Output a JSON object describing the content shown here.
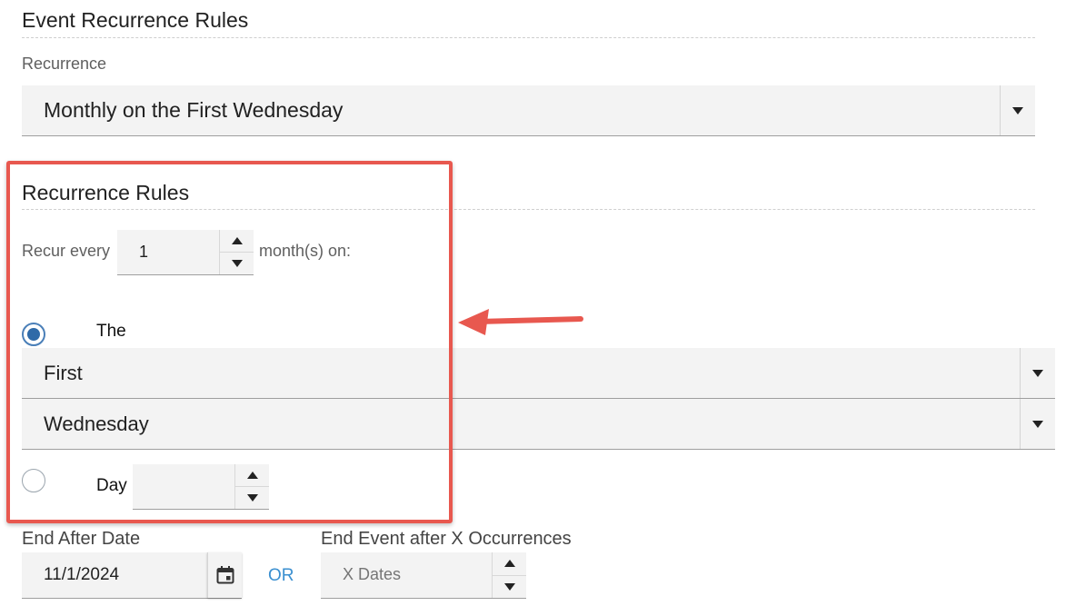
{
  "event_recurrence": {
    "heading": "Event Recurrence Rules",
    "recurrence_label": "Recurrence",
    "recurrence_value": "Monthly on the First Wednesday"
  },
  "recurrence_rules": {
    "heading": "Recurrence Rules",
    "recur_every_label": "Recur every",
    "recur_every_value": "1",
    "recur_unit_label": "month(s) on:",
    "option_the_label": "The",
    "option_the_selected": true,
    "ordinal_value": "First",
    "weekday_value": "Wednesday",
    "option_day_label": "Day",
    "option_day_selected": false,
    "day_value": ""
  },
  "end": {
    "end_after_date_label": "End After Date",
    "end_after_date_value": "11/1/2024",
    "or_label": "OR",
    "occurrences_label": "End Event after X Occurrences",
    "occurrences_placeholder": "X Dates"
  },
  "colors": {
    "highlight": "#e8584f",
    "accent_link": "#3a8fd0",
    "radio_selected": "#2f6aa8"
  },
  "icons": [
    "chevron-down-icon",
    "spinner-up-icon",
    "spinner-down-icon",
    "calendar-icon",
    "arrow-annotation-icon"
  ]
}
